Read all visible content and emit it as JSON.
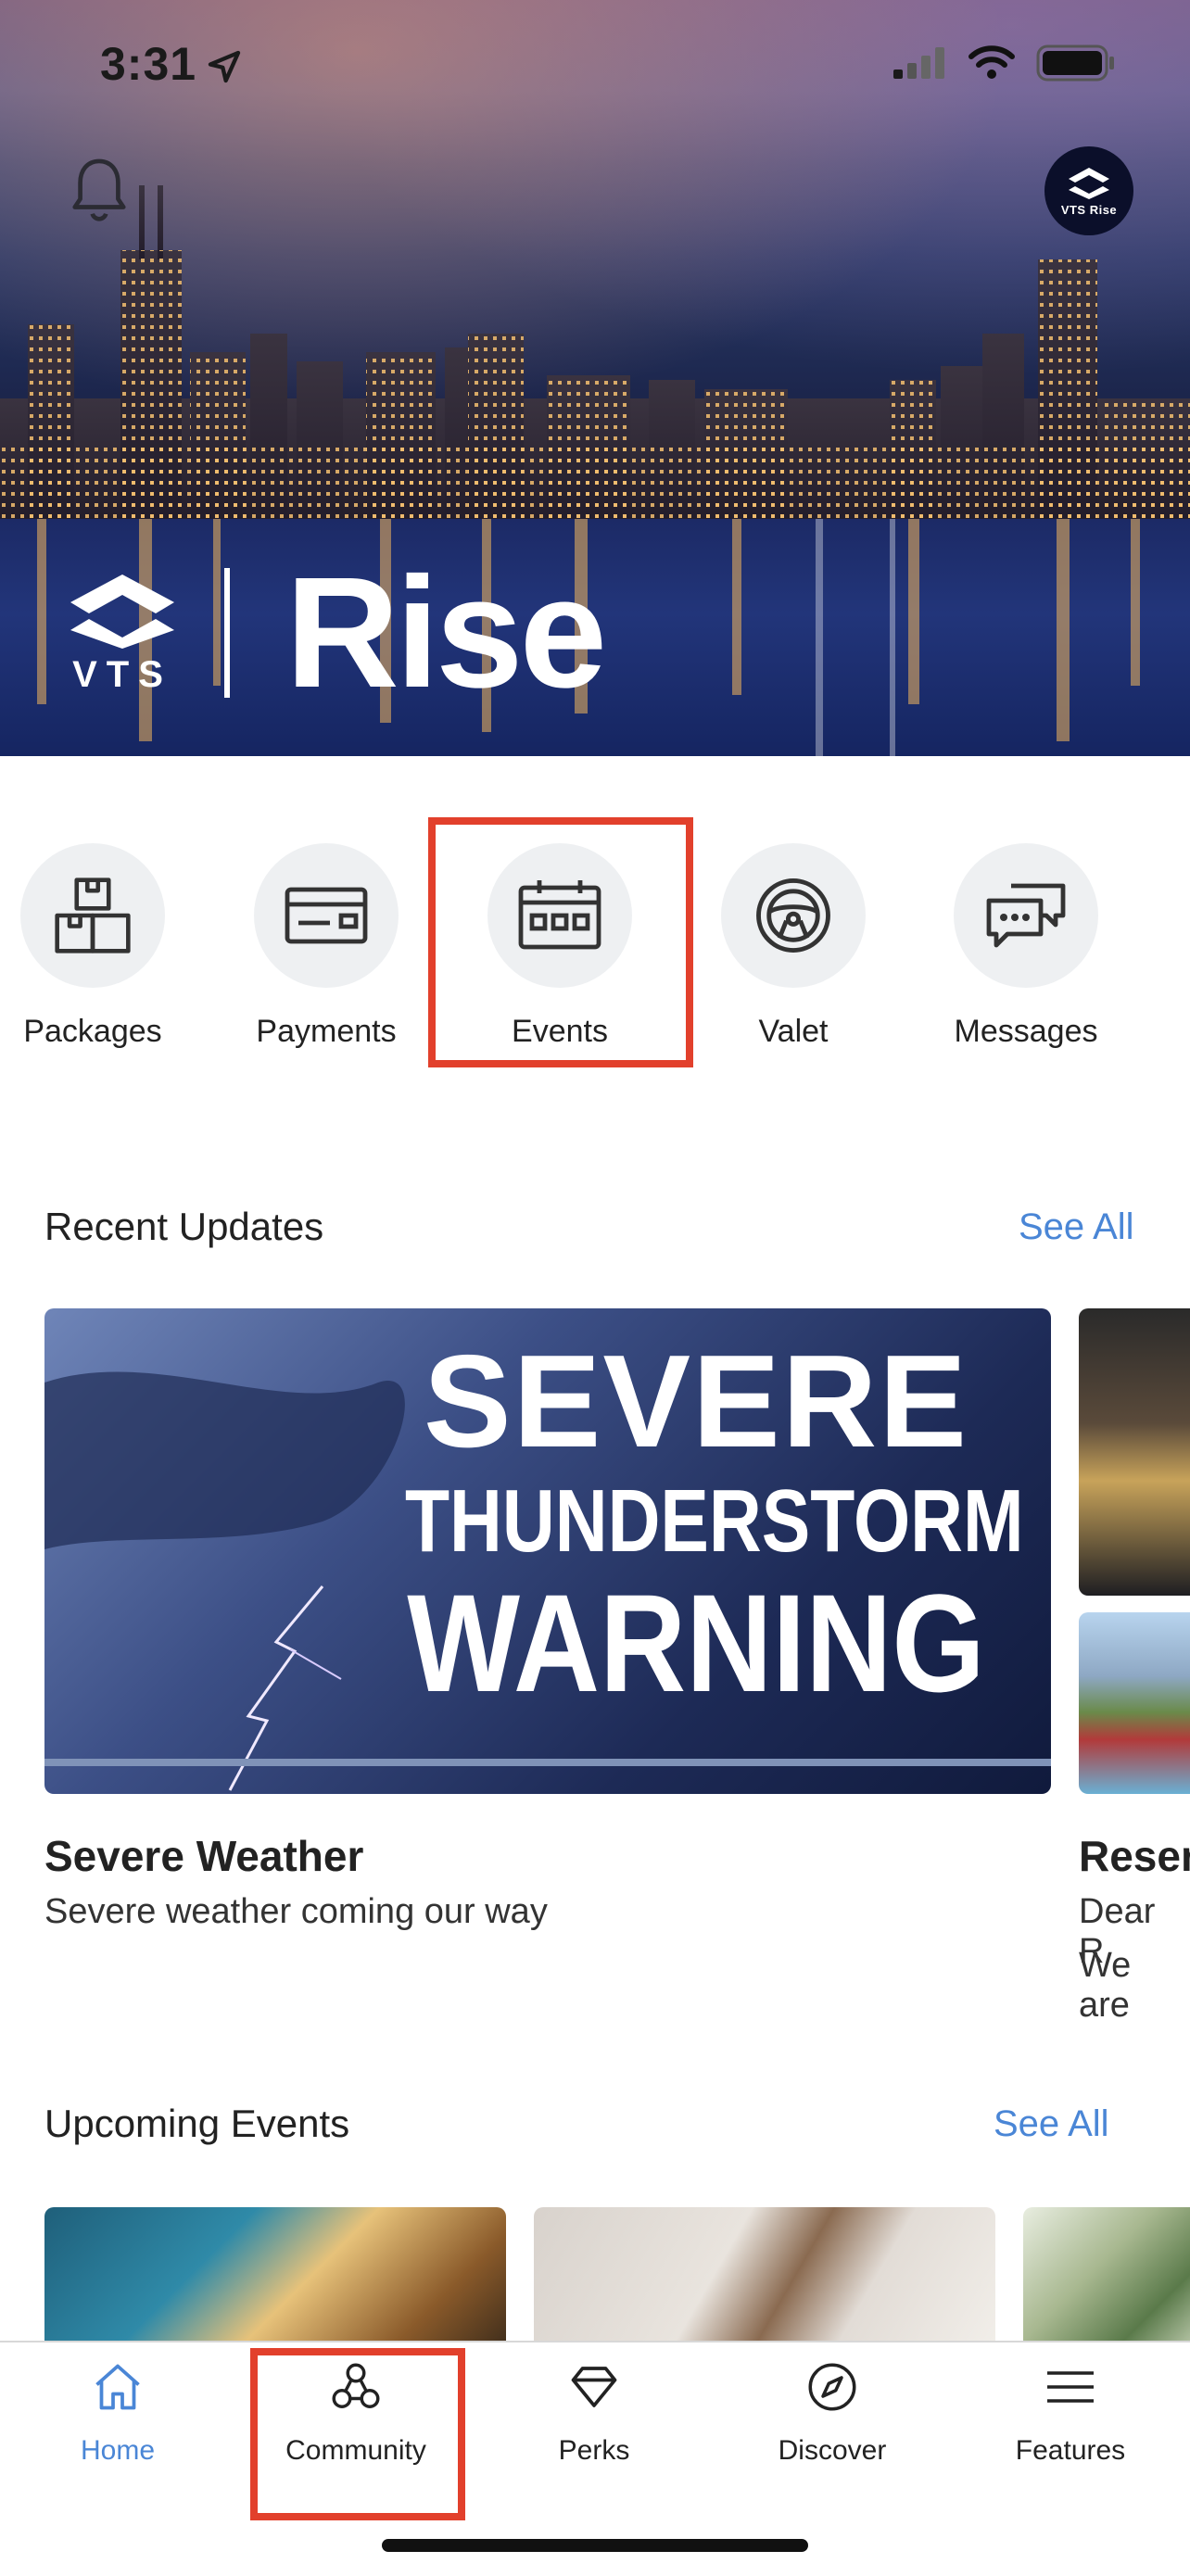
{
  "status_bar": {
    "time": "3:31"
  },
  "brand": {
    "logo_text": "VTS",
    "name": "Rise",
    "badge_text": "VTS Rise"
  },
  "quick_actions": [
    {
      "label": "Packages",
      "icon": "packages-icon"
    },
    {
      "label": "Payments",
      "icon": "payments-icon"
    },
    {
      "label": "Events",
      "icon": "calendar-icon"
    },
    {
      "label": "Valet",
      "icon": "steering-wheel-icon"
    },
    {
      "label": "Messages",
      "icon": "messages-icon"
    }
  ],
  "recent_updates": {
    "title": "Recent Updates",
    "see_all": "See All",
    "cards": [
      {
        "image_text": [
          "SEVERE",
          "THUNDERSTORM",
          "WARNING"
        ],
        "title": "Severe Weather",
        "subtitle": "Severe weather coming our way"
      },
      {
        "title": "Reser",
        "line1": "Dear R",
        "line2": "We are"
      }
    ]
  },
  "upcoming_events": {
    "title": "Upcoming Events",
    "see_all": "See All"
  },
  "bottom_nav": [
    {
      "label": "Home",
      "icon": "home-icon",
      "active": true
    },
    {
      "label": "Community",
      "icon": "community-icon",
      "active": false
    },
    {
      "label": "Perks",
      "icon": "diamond-icon",
      "active": false
    },
    {
      "label": "Discover",
      "icon": "compass-icon",
      "active": false
    },
    {
      "label": "Features",
      "icon": "menu-icon",
      "active": false
    }
  ],
  "colors": {
    "accent": "#4a86d6",
    "highlight": "#e2402c"
  }
}
